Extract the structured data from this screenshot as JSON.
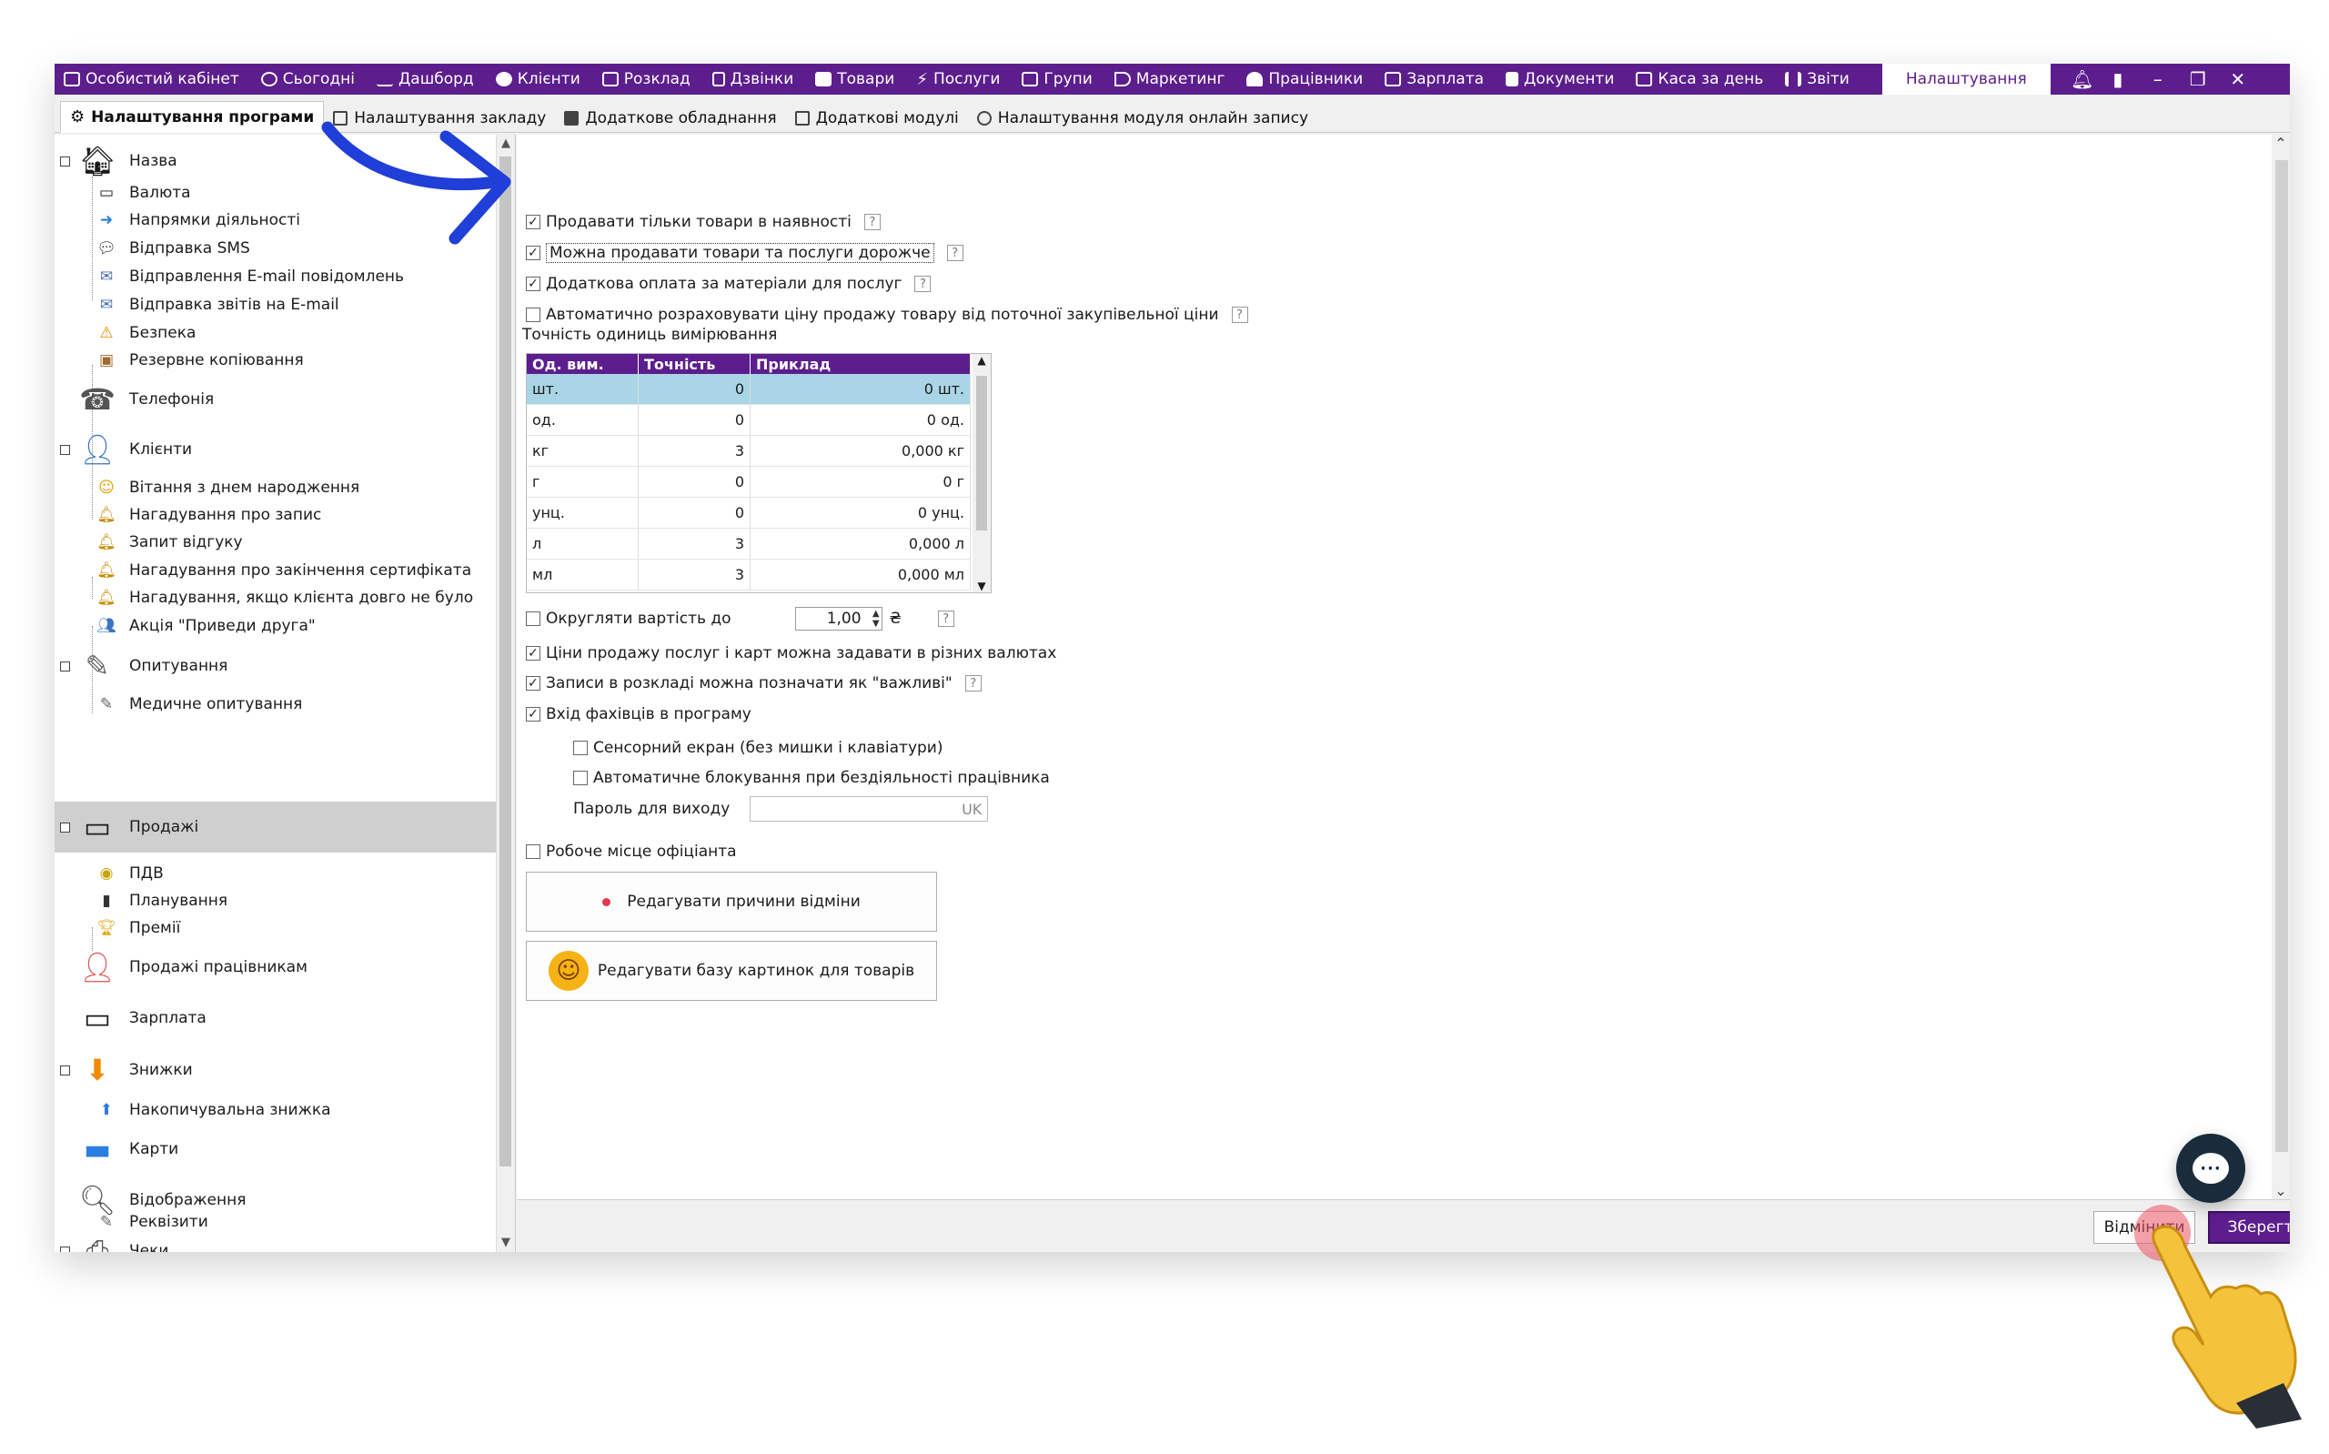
{
  "nav": {
    "items": [
      {
        "label": "Особистий кабінет",
        "icon": "briefcase-icon"
      },
      {
        "label": "Сьогодні",
        "icon": "clock-icon"
      },
      {
        "label": "Дашборд",
        "icon": "pulse-icon"
      },
      {
        "label": "Клієнти",
        "icon": "user-icon"
      },
      {
        "label": "Розклад",
        "icon": "calendar-icon"
      },
      {
        "label": "Дзвінки",
        "icon": "phone-icon"
      },
      {
        "label": "Товари",
        "icon": "box-icon"
      },
      {
        "label": "Послуги",
        "icon": "lightning-icon"
      },
      {
        "label": "Групи",
        "icon": "groups-icon"
      },
      {
        "label": "Маркетинг",
        "icon": "megaphone-icon"
      },
      {
        "label": "Працівники",
        "icon": "staff-icon"
      },
      {
        "label": "Зарплата",
        "icon": "money-icon"
      },
      {
        "label": "Документи",
        "icon": "document-icon"
      },
      {
        "label": "Каса за день",
        "icon": "cashbox-icon"
      },
      {
        "label": "Звіти",
        "icon": "chart-icon"
      }
    ],
    "active": "Налаштування"
  },
  "tabs": [
    {
      "label": "Налаштування програми",
      "active": true
    },
    {
      "label": "Налаштування закладу"
    },
    {
      "label": "Додаткове обладнання"
    },
    {
      "label": "Додаткові модулі"
    },
    {
      "label": "Налаштування модуля онлайн запису"
    }
  ],
  "tree": {
    "name": "Назва",
    "currency": "Валюта",
    "directions": "Напрямки діяльності",
    "sms": "Відправка SMS",
    "email_notif": "Відправлення E-mail повідомлень",
    "email_reports": "Відправка звітів на E-mail",
    "security": "Безпека",
    "backup": "Резервне копіювання",
    "telephony": "Телефонія",
    "clients": "Клієнти",
    "birthday": "Вітання з днем народження",
    "reminder_visit": "Нагадування про запис",
    "review": "Запит відгуку",
    "reminder_cert": "Нагадування про закінчення сертифіката",
    "reminder_absent": "Нагадування, якщо клієнта довго не було",
    "referral": "Акція \"Приведи друга\"",
    "surveys": "Опитування",
    "medical_survey": "Медичне опитування",
    "sales": "Продажі",
    "vat": "ПДВ",
    "planning": "Планування",
    "bonuses": "Премії",
    "staff_sales": "Продажі працівникам",
    "salary": "Зарплата",
    "discounts": "Знижки",
    "cumulative": "Накопичувальна знижка",
    "cards": "Карти",
    "display": "Відображення",
    "receipts": "Чеки",
    "requisites": "Реквізити"
  },
  "settings": {
    "only_in_stock": "Продавати тільки товари в наявності",
    "sell_higher": "Можна продавати товари та послуги дорожче",
    "extra_materials": "Додаткова оплата за матеріали для послуг",
    "auto_price": "Автоматично розраховувати ціну продажу товару від поточної закупівельної ціни",
    "units_precision": "Точність одиниць вимірювання",
    "round_to": "Округляти вартість до",
    "round_value": "1,00",
    "currency_symbol": "₴",
    "multi_currency": "Ціни продажу послуг і карт можна задавати в різних валютах",
    "important": "Записи в розкладі можна позначати як \"важливі\"",
    "specialist_login": "Вхід фахівців в програму",
    "touch_screen": "Сенсорний екран (без мишки і клавіатури)",
    "auto_lock": "Автоматичне блокування при бездіяльності працівника",
    "exit_password": "Пароль для виходу",
    "password_lang": "UK",
    "waiter": "Робоче місце офіціанта",
    "edit_reasons": "Редагувати причини відміни",
    "edit_images": "Редагувати базу картинок для товарів",
    "help": "?"
  },
  "units": {
    "headers": [
      "Од. вим.",
      "Точність",
      "Приклад"
    ],
    "rows": [
      {
        "unit": "шт.",
        "precision": "0",
        "example": "0 шт."
      },
      {
        "unit": "од.",
        "precision": "0",
        "example": "0 од."
      },
      {
        "unit": "кг",
        "precision": "3",
        "example": "0,000 кг"
      },
      {
        "unit": "г",
        "precision": "0",
        "example": "0 г"
      },
      {
        "unit": "унц.",
        "precision": "0",
        "example": "0 унц."
      },
      {
        "unit": "л",
        "precision": "3",
        "example": "0,000 л"
      },
      {
        "unit": "мл",
        "precision": "3",
        "example": "0,000 мл"
      }
    ]
  },
  "footer": {
    "cancel": "Відмінити",
    "save": "Зберегти"
  },
  "colors": {
    "brand": "#5c1d8d",
    "arrow": "#1f3fd8",
    "selected_row": "#a9d5e6"
  }
}
